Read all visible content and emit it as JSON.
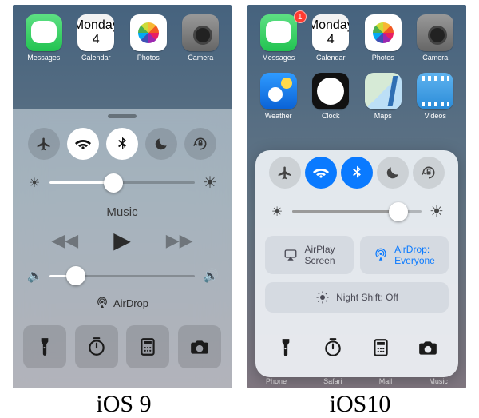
{
  "captions": {
    "left": "iOS 9",
    "right": "iOS10"
  },
  "date": {
    "dow": "Monday",
    "dom": "4"
  },
  "ios9": {
    "apps_row1": [
      {
        "name": "messages",
        "label": "Messages"
      },
      {
        "name": "calendar",
        "label": "Calendar"
      },
      {
        "name": "photos",
        "label": "Photos"
      },
      {
        "name": "camera",
        "label": "Camera"
      }
    ],
    "toggles": [
      {
        "name": "airplane",
        "on": false
      },
      {
        "name": "wifi",
        "on": true
      },
      {
        "name": "bluetooth",
        "on": true
      },
      {
        "name": "dnd",
        "on": false
      },
      {
        "name": "rotation-lock",
        "on": false
      }
    ],
    "brightness_pct": 44,
    "music_label": "Music",
    "volume_pct": 18,
    "airdrop_label": "AirDrop",
    "shortcuts": [
      "flashlight",
      "timer",
      "calculator",
      "camera"
    ]
  },
  "ios10": {
    "apps_row1": [
      {
        "name": "messages",
        "label": "Messages",
        "badge": "1"
      },
      {
        "name": "calendar",
        "label": "Calendar"
      },
      {
        "name": "photos",
        "label": "Photos"
      },
      {
        "name": "camera",
        "label": "Camera"
      }
    ],
    "apps_row2": [
      {
        "name": "weather",
        "label": "Weather"
      },
      {
        "name": "clock",
        "label": "Clock"
      },
      {
        "name": "maps",
        "label": "Maps"
      },
      {
        "name": "videos",
        "label": "Videos"
      }
    ],
    "toggles": [
      {
        "name": "airplane",
        "on": false
      },
      {
        "name": "wifi",
        "on": true
      },
      {
        "name": "bluetooth",
        "on": true
      },
      {
        "name": "dnd",
        "on": false
      },
      {
        "name": "rotation-lock",
        "on": false
      }
    ],
    "brightness_pct": 82,
    "airplay_label": "AirPlay\nScreen",
    "airdrop_label": "AirDrop:\nEveryone",
    "nightshift_label": "Night Shift: Off",
    "shortcuts": [
      "flashlight",
      "timer",
      "calculator",
      "camera"
    ],
    "dock_labels": [
      "Phone",
      "Safari",
      "Mail",
      "Music"
    ]
  },
  "colors": {
    "ios10_accent": "#0a7aff"
  }
}
